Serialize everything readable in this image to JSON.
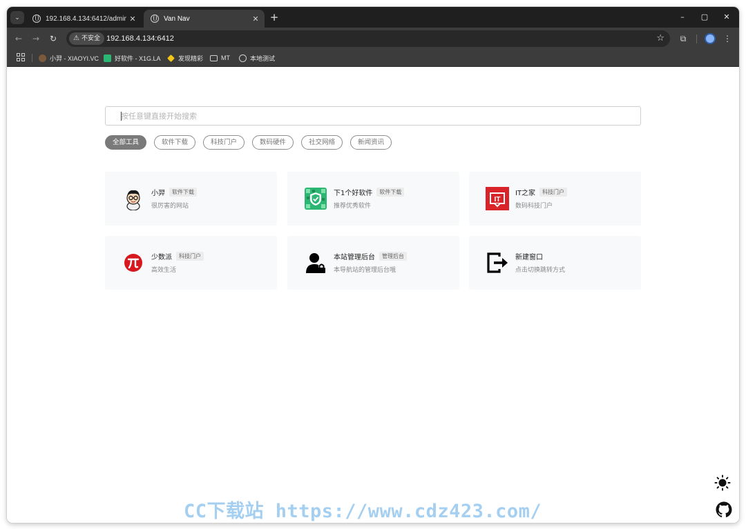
{
  "browser": {
    "tabs": [
      {
        "title": "192.168.4.134:6412/admin/t",
        "close": "✕"
      },
      {
        "title": "Van Nav",
        "close": "✕"
      }
    ],
    "new_tab": "+",
    "window_controls": [
      "–",
      "▢",
      "✕"
    ],
    "address": {
      "security_label": "不安全",
      "url": "192.168.4.134:6412"
    },
    "bookmarks": [
      {
        "label": "小羿 - XIAOYI.VC",
        "icon": "avatar-icon",
        "color": "#7a5a3a"
      },
      {
        "label": "好软件 - X1G.LA",
        "icon": "x1g-icon",
        "color": "#2bb673"
      },
      {
        "label": "发现精彩",
        "icon": "diamond-icon",
        "color": "#f5c518"
      },
      {
        "label": "MT",
        "icon": "folder-icon",
        "color": "#cfcfcf"
      },
      {
        "label": "本地测试",
        "icon": "globe-icon",
        "color": "#cfcfcf"
      }
    ]
  },
  "search": {
    "placeholder": "按任意键直接开始搜索"
  },
  "filters": [
    {
      "label": "全部工具",
      "active": true
    },
    {
      "label": "软件下载",
      "active": false
    },
    {
      "label": "科技门户",
      "active": false
    },
    {
      "label": "数码硬件",
      "active": false
    },
    {
      "label": "社交网络",
      "active": false
    },
    {
      "label": "新闻资讯",
      "active": false
    }
  ],
  "cards": [
    {
      "title": "小羿",
      "tag": "软件下载",
      "desc": "很厉害的网站",
      "icon": "cartoon-avatar-icon"
    },
    {
      "title": "下1个好软件",
      "tag": "软件下载",
      "desc": "推荐优秀软件",
      "icon": "shield-check-icon"
    },
    {
      "title": "IT之家",
      "tag": "科技门户",
      "desc": "数码科技门户",
      "icon": "ithome-logo-icon"
    },
    {
      "title": "少数派",
      "tag": "科技门户",
      "desc": "高效生活",
      "icon": "pi-logo-icon"
    },
    {
      "title": "本站管理后台",
      "tag": "管理后台",
      "desc": "本导航站的管理后台哦",
      "icon": "user-lock-icon"
    },
    {
      "title": "新建窗口",
      "tag": "",
      "desc": "点击切换跳转方式",
      "icon": "exit-arrow-icon"
    }
  ],
  "watermark": "CC下载站 https://www.cdz423.com/",
  "colors": {
    "chrome_dark": "#1f1f1f",
    "toolbar": "#3c3c3c",
    "card_bg": "#f8f9fa",
    "active_chip": "#7a7a7a",
    "ithome_red": "#d9252a",
    "sspai_red": "#d7191f",
    "x1g_green": "#2bb673"
  }
}
